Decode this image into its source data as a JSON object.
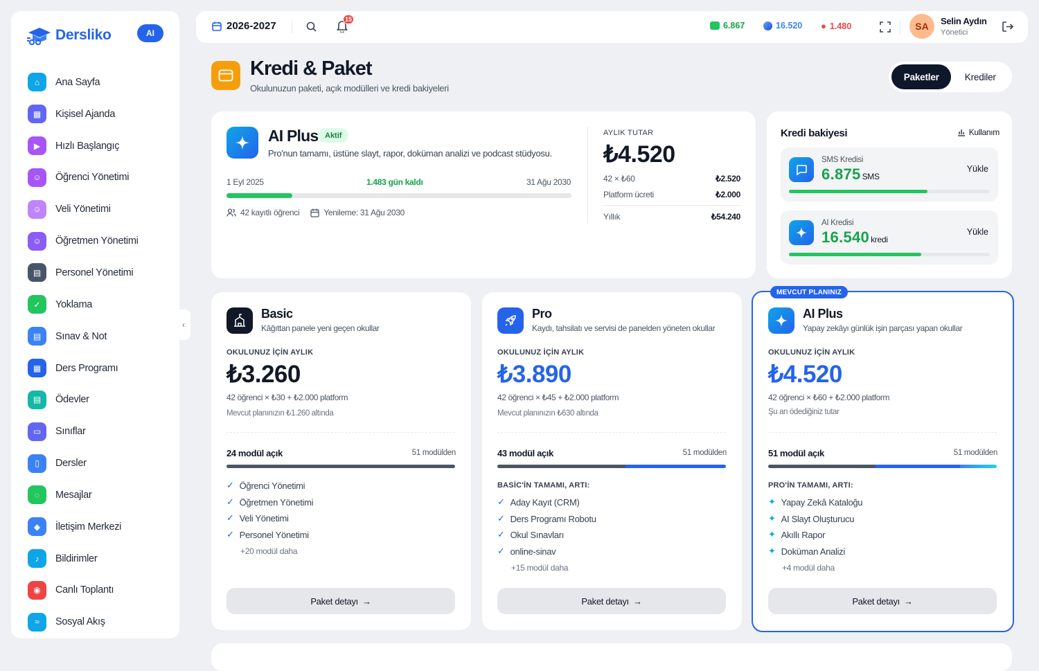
{
  "brand": {
    "name": "Dersliko",
    "ai_badge": "AI",
    "color": "#2563eb"
  },
  "sidebar": {
    "items": [
      {
        "label": "Ana Sayfa",
        "icon": "home-icon",
        "color": "#0ea5e9"
      },
      {
        "label": "Kişisel Ajanda",
        "icon": "calendar-icon",
        "color": "#6366f1"
      },
      {
        "label": "Hızlı Başlangıç",
        "icon": "play-icon",
        "color": "#a855f7"
      },
      {
        "label": "Öğrenci Yönetimi",
        "icon": "users-icon",
        "color": "#a855f7"
      },
      {
        "label": "Veli Yönetimi",
        "icon": "users-icon",
        "color": "#c084fc"
      },
      {
        "label": "Öğretmen Yönetimi",
        "icon": "teacher-icon",
        "color": "#8b5cf6"
      },
      {
        "label": "Personel Yönetimi",
        "icon": "id-card-icon",
        "color": "#475569"
      },
      {
        "label": "Yoklama",
        "icon": "clipboard-check-icon",
        "color": "#22c55e"
      },
      {
        "label": "Sınav & Not",
        "icon": "exam-icon",
        "color": "#3b82f6"
      },
      {
        "label": "Ders Programı",
        "icon": "schedule-icon",
        "color": "#2563eb"
      },
      {
        "label": "Ödevler",
        "icon": "homework-icon",
        "color": "#14b8a6"
      },
      {
        "label": "Sınıflar",
        "icon": "monitor-icon",
        "color": "#6366f1"
      },
      {
        "label": "Dersler",
        "icon": "book-icon",
        "color": "#3b82f6"
      },
      {
        "label": "Mesajlar",
        "icon": "chat-icon",
        "color": "#22c55e"
      },
      {
        "label": "İletişim Merkezi",
        "icon": "megaphone-icon",
        "color": "#3b82f6"
      },
      {
        "label": "Bildirimler",
        "icon": "bell-icon",
        "color": "#0ea5e9"
      },
      {
        "label": "Canlı Toplantı",
        "icon": "broadcast-icon",
        "color": "#ef4444"
      },
      {
        "label": "Sosyal Akış",
        "icon": "rss-icon",
        "color": "#0ea5e9"
      }
    ]
  },
  "topbar": {
    "year": "2026-2027",
    "notification_count": "15",
    "stats": [
      {
        "value": "6.867",
        "icon": "sms-icon",
        "color": "#16a34a"
      },
      {
        "value": "16.520",
        "icon": "ai-icon",
        "color": "#3b82f6"
      },
      {
        "value": "1.480",
        "icon": "fire-icon",
        "color": "#ef4444"
      }
    ],
    "user": {
      "initials": "SA",
      "name": "Selin Aydın",
      "role": "Yönetici"
    }
  },
  "page": {
    "title": "Kredi & Paket",
    "subtitle": "Okulunuzun paketi, açık modülleri ve kredi bakiyeleri",
    "tabs": {
      "packages": "Paketler",
      "credits": "Krediler"
    }
  },
  "current_plan": {
    "name": "AI Plus",
    "status": "Aktif",
    "description": "Pro'nun tamamı, üstüne slayt, rapor, doküman analizi ve podcast stüdyosu.",
    "start": "1 Eyl 2025",
    "remaining": "1.483 gün kaldı",
    "end": "31 Ağu 2030",
    "progress": 0.19,
    "students": "42 kayıtlı öğrenci",
    "renewal": "Yenileme: 31 Ağu 2030",
    "amount_label": "AYLIK TUTAR",
    "amount": "₺4.520",
    "rows": [
      {
        "label": "42 × ₺60",
        "value": "₺2.520"
      },
      {
        "label": "Platform ücreti",
        "value": "₺2.000"
      },
      {
        "label": "Yıllık",
        "value": "₺54.240"
      }
    ]
  },
  "credits": {
    "title": "Kredi bakiyesi",
    "usage": "Kullanım",
    "items": [
      {
        "label": "SMS Kredisi",
        "value": "6.875",
        "unit": "SMS",
        "action": "Yükle",
        "fill": 0.69,
        "icon": "chat-icon"
      },
      {
        "label": "AI Kredisi",
        "value": "16.540",
        "unit": "kredi",
        "action": "Yükle",
        "fill": 0.66,
        "icon": "sparkle-icon"
      }
    ]
  },
  "plans": [
    {
      "name": "Basic",
      "desc": "Kâğıttan panele yeni geçen okullar",
      "price_label": "OKULUNUZ İÇİN AYLIK",
      "price": "₺3.260",
      "formula": "42 öğrenci × ₺30 + ₺2.000 platform",
      "note": "Mevcut planınızın ₺1.260 altında",
      "modules": "24 modül açık",
      "of": "51 modülden",
      "section": "",
      "features": [
        "Öğrenci Yönetimi",
        "Öğretmen Yönetimi",
        "Veli Yönetimi",
        "Personel Yönetimi"
      ],
      "more": "+20 modül daha",
      "button": "Paket detayı",
      "color": "#111827"
    },
    {
      "name": "Pro",
      "desc": "Kaydı, tahsilatı ve servisi de panelden yöneten okullar",
      "price_label": "OKULUNUZ İÇİN AYLIK",
      "price": "₺3.890",
      "formula": "42 öğrenci × ₺45 + ₺2.000 platform",
      "note": "Mevcut planınızın ₺630 altında",
      "modules": "43 modül açık",
      "of": "51 modülden",
      "section": "BASİC'İN TAMAMI, ARTI:",
      "features": [
        "Aday Kayıt (CRM)",
        "Ders Programı Robotu",
        "Okul Sınavları",
        "online-sinav"
      ],
      "more": "+15 modül daha",
      "button": "Paket detayı",
      "color": "#2563eb"
    },
    {
      "name": "AI Plus",
      "desc": "Yapay zekâyı günlük işin parçası yapan okullar",
      "ribbon": "MEVCUT PLANINIZ",
      "price_label": "OKULUNUZ İÇİN AYLIK",
      "price": "₺4.520",
      "formula": "42 öğrenci × ₺60 + ₺2.000 platform",
      "note": "Şu an ödediğiniz tutar",
      "modules": "51 modül açık",
      "of": "51 modülden",
      "section": "PRO'İN TAMAMI, ARTI:",
      "features": [
        "Yapay Zekâ Kataloğu",
        "AI Slayt Oluşturucu",
        "Akıllı Rapor",
        "Doküman Analizi"
      ],
      "more": "+4 modül daha",
      "button": "Paket detayı",
      "color": "#2563eb"
    }
  ]
}
